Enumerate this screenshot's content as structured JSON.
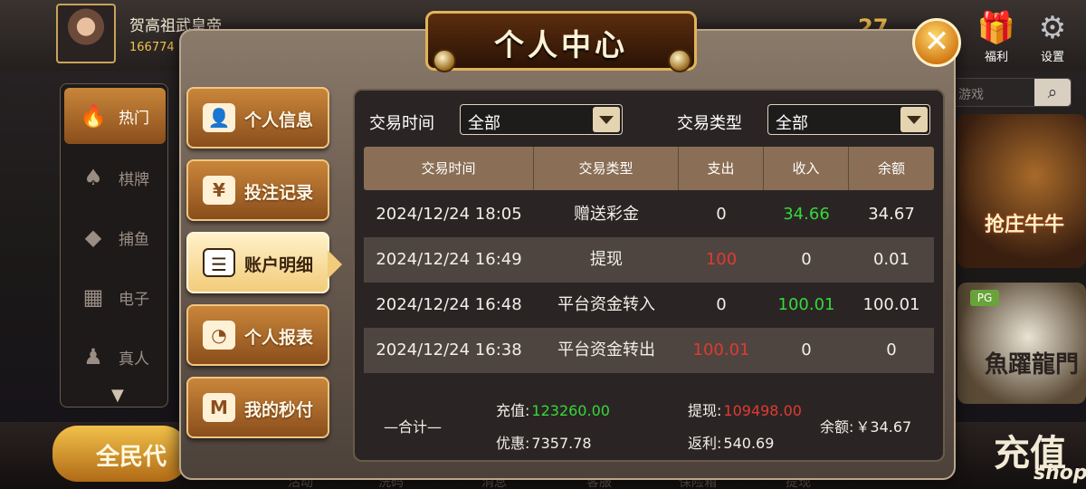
{
  "lobby": {
    "nickname": "贺高祖武皇帝",
    "uid": "166774",
    "balance_partial": "27",
    "gift_label": "福利",
    "settings_label": "设置",
    "search_placeholder": "游戏",
    "side_items": [
      {
        "label": "热门",
        "icon": "hot-icon"
      },
      {
        "label": "棋牌",
        "icon": "cards-icon"
      },
      {
        "label": "捕鱼",
        "icon": "fish-icon"
      },
      {
        "label": "电子",
        "icon": "slot-icon"
      },
      {
        "label": "真人",
        "icon": "dealer-icon"
      }
    ],
    "agent_button": "全民代",
    "recharge_big": "充值",
    "recharge_small": "shop",
    "games": [
      {
        "label": "抢庄牛牛"
      },
      {
        "label": "魚躍龍門",
        "badge": "PG"
      }
    ],
    "bottom_nav": [
      "活动",
      "洗码",
      "消息",
      "客服",
      "保险箱",
      "提现"
    ]
  },
  "dialog": {
    "title": "个人中心",
    "close_glyph": "✕",
    "menu": [
      {
        "label": "个人信息",
        "icon": "user-icon"
      },
      {
        "label": "投注记录",
        "icon": "bet-record-icon"
      },
      {
        "label": "账户明细",
        "icon": "account-detail-icon"
      },
      {
        "label": "个人报表",
        "icon": "report-icon"
      },
      {
        "label": "我的秒付",
        "icon": "quick-pay-icon"
      }
    ],
    "active_menu": 2,
    "filters": {
      "time_label": "交易时间",
      "time_value": "全部",
      "type_label": "交易类型",
      "type_value": "全部"
    },
    "table": {
      "headers": [
        "交易时间",
        "交易类型",
        "支出",
        "收入",
        "余额"
      ],
      "rows": [
        {
          "time": "2024/12/24 18:05",
          "type": "赠送彩金",
          "out": "0",
          "in": "34.66",
          "balance": "34.67"
        },
        {
          "time": "2024/12/24 16:49",
          "type": "提现",
          "out": "100",
          "in": "0",
          "balance": "0.01"
        },
        {
          "time": "2024/12/24 16:48",
          "type": "平台资金转入",
          "out": "0",
          "in": "100.01",
          "balance": "100.01"
        },
        {
          "time": "2024/12/24 16:38",
          "type": "平台资金转出",
          "out": "100.01",
          "in": "0",
          "balance": "0"
        }
      ]
    },
    "summary": {
      "label": "—合计—",
      "recharge_label": "充值:",
      "recharge": "123260.00",
      "discount_label": "优惠:",
      "discount": "7357.78",
      "withdraw_label": "提现:",
      "withdraw": "109498.00",
      "rebate_label": "返利:",
      "rebate": "540.69",
      "balance_label": "余额:",
      "balance": "￥34.67"
    }
  },
  "colors": {
    "expense": "#e03a32",
    "income": "#36d83a",
    "accent_gold": "#e1b35a"
  }
}
